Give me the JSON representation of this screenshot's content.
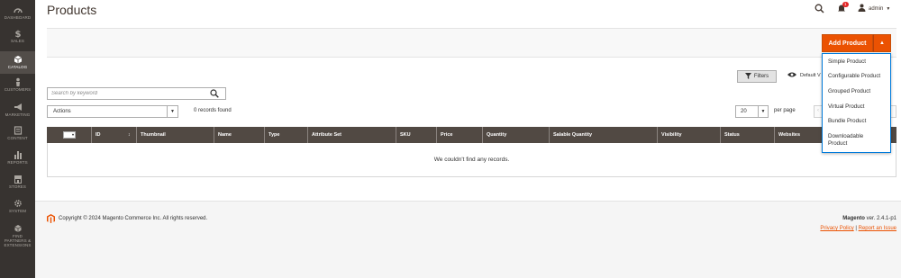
{
  "sidebar": {
    "items": [
      {
        "label": "DASHBOARD",
        "icon": "dashboard-icon"
      },
      {
        "label": "SALES",
        "icon": "dollar-icon"
      },
      {
        "label": "CATALOG",
        "icon": "catalog-box-icon",
        "active": true
      },
      {
        "label": "CUSTOMERS",
        "icon": "person-icon"
      },
      {
        "label": "MARKETING",
        "icon": "megaphone-icon"
      },
      {
        "label": "CONTENT",
        "icon": "content-icon"
      },
      {
        "label": "REPORTS",
        "icon": "bar-chart-icon"
      },
      {
        "label": "STORES",
        "icon": "store-icon"
      },
      {
        "label": "SYSTEM",
        "icon": "gear-icon"
      },
      {
        "label": "FIND PARTNERS & EXTENSIONS",
        "icon": "cubes-icon"
      }
    ]
  },
  "header": {
    "title": "Products",
    "notifications_count": "1",
    "user": "admin"
  },
  "add_product": {
    "label": "Add Product",
    "menu": [
      "Simple Product",
      "Configurable Product",
      "Grouped Product",
      "Virtual Product",
      "Bundle Product",
      "Downloadable Product"
    ]
  },
  "toolbar": {
    "filters_label": "Filters",
    "view_label": "Default V",
    "search_placeholder": "Search by keyword",
    "actions_value": "Actions",
    "records_found": "0 records found",
    "per_page_value": "20",
    "per_page_label": "per page"
  },
  "grid": {
    "columns": [
      "ID",
      "Thumbnail",
      "Name",
      "Type",
      "Attribute Set",
      "SKU",
      "Price",
      "Quantity",
      "Salable Quantity",
      "Visibility",
      "Status",
      "Websites"
    ],
    "sort_indicator": "↕",
    "empty_message": "We couldn't find any records."
  },
  "footer": {
    "copyright": "Copyright © 2024 Magento Commerce Inc. All rights reserved.",
    "version_brand": "Magento",
    "version_text": " ver. 2.4.1-p1",
    "privacy_link": "Privacy Policy",
    "separator": "|",
    "report_link": "Report an Issue"
  },
  "colors": {
    "sidebar_bg": "#373330",
    "accent_orange": "#eb5202",
    "grid_header": "#514943",
    "dropdown_border": "#007bdb"
  }
}
